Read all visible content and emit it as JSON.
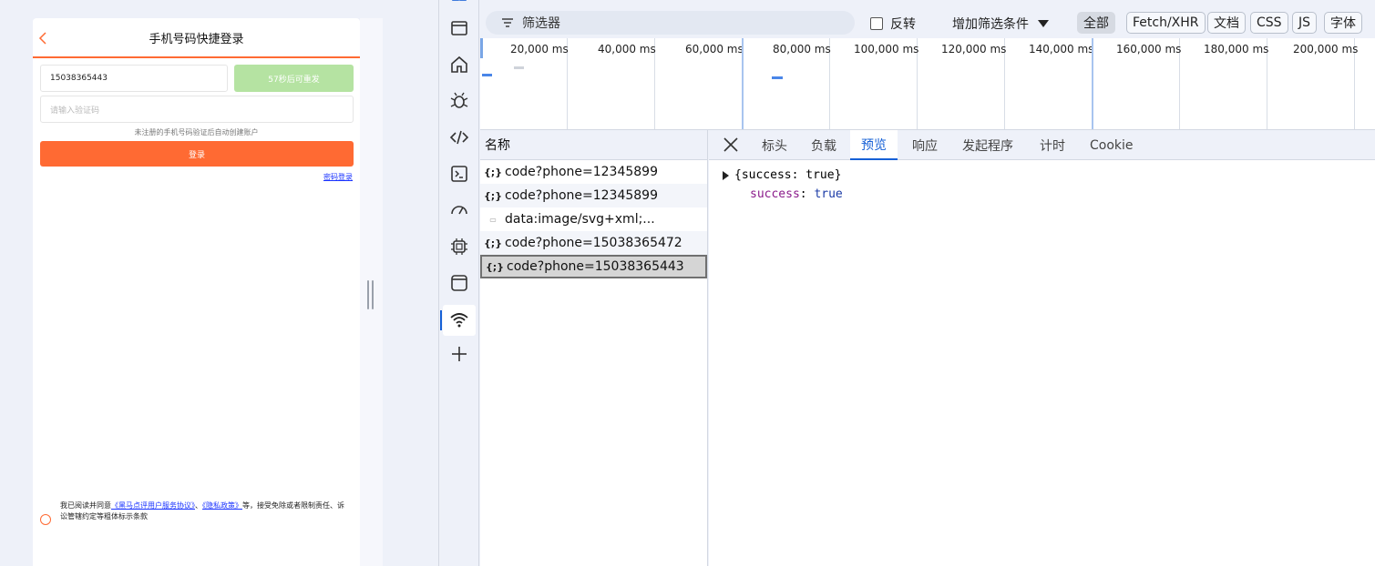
{
  "mobile": {
    "title": "手机号码快捷登录",
    "phone_value": "15038365443",
    "resend_label": "57秒后可重发",
    "code_placeholder": "请输入验证码",
    "hint": "未注册的手机号码验证后自动创建账户",
    "login_label": "登录",
    "password_login": "密码登录",
    "agreement": {
      "prefix": "我已阅读并同意",
      "link1": "《黑马点评用户服务协议》",
      "sep": "、",
      "link2": "《隐私政策》",
      "suffix": "等，接受免除或者限制责任、诉讼管辖约定等粗体标示条款"
    },
    "accent": "#ff6a33",
    "resend_color": "#b5e3a2"
  },
  "filter": {
    "placeholder": "筛选器",
    "invert_label": "反转",
    "more_filters": "增加筛选条件",
    "types": [
      "全部",
      "Fetch/XHR",
      "文档",
      "CSS",
      "JS",
      "字体"
    ]
  },
  "timeline": {
    "ticks": [
      "20,000 ms",
      "40,000 ms",
      "60,000 ms",
      "80,000 ms",
      "100,000 ms",
      "120,000 ms",
      "140,000 ms",
      "160,000 ms",
      "180,000 ms",
      "200,000 ms"
    ]
  },
  "requests": {
    "header": "名称",
    "rows": [
      {
        "icon": "{;}",
        "name": "code?phone=12345899"
      },
      {
        "icon": "{;}",
        "name": "code?phone=12345899"
      },
      {
        "icon": "img",
        "name": "data:image/svg+xml;..."
      },
      {
        "icon": "{;}",
        "name": "code?phone=15038365472"
      },
      {
        "icon": "{;}",
        "name": "code?phone=15038365443"
      }
    ]
  },
  "detail": {
    "tabs": [
      "标头",
      "负载",
      "预览",
      "响应",
      "发起程序",
      "计时",
      "Cookie"
    ],
    "active_tab": "预览",
    "preview": {
      "summary": "{success: true}",
      "key": "success",
      "colon": ": ",
      "value": "true"
    }
  }
}
